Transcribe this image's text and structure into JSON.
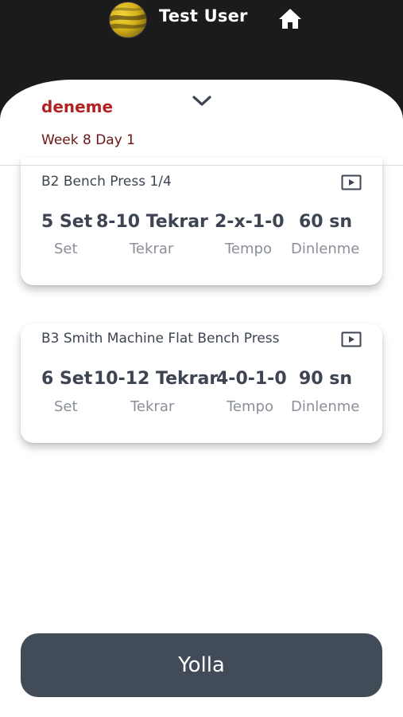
{
  "header": {
    "user_name": "Test User",
    "avatar_icon": "user-avatar",
    "home_icon": "home-icon"
  },
  "program": {
    "title": "deneme",
    "week_day": "Week 8 Day 1",
    "toggle_icon": "chevron-down-icon"
  },
  "exercises": [
    {
      "name": "B2 Bench Press 1/4",
      "video_icon": "play-video-icon",
      "stats": [
        {
          "value": "5 Set",
          "label": "Set"
        },
        {
          "value": "8-10 Tekrar",
          "label": "Tekrar"
        },
        {
          "value": "2-x-1-0",
          "label": "Tempo"
        },
        {
          "value": "60 sn",
          "label": "Dinlenme"
        }
      ]
    },
    {
      "name": "B3 Smith Machine Flat Bench Press",
      "video_icon": "play-video-icon",
      "stats": [
        {
          "value": "6 Set",
          "label": "Set"
        },
        {
          "value": "10-12 Tekrar",
          "label": "Tekrar"
        },
        {
          "value": "4-0-1-0",
          "label": "Tempo"
        },
        {
          "value": "90 sn",
          "label": "Dinlenme"
        }
      ]
    }
  ],
  "footer": {
    "send_label": "Yolla"
  },
  "colors": {
    "topbar": "#1b1b1b",
    "title_red": "#b22222",
    "subtitle_red": "#6b1616",
    "text_dark": "#3d4452",
    "text_muted": "#8a8f99",
    "button": "#424c59"
  }
}
